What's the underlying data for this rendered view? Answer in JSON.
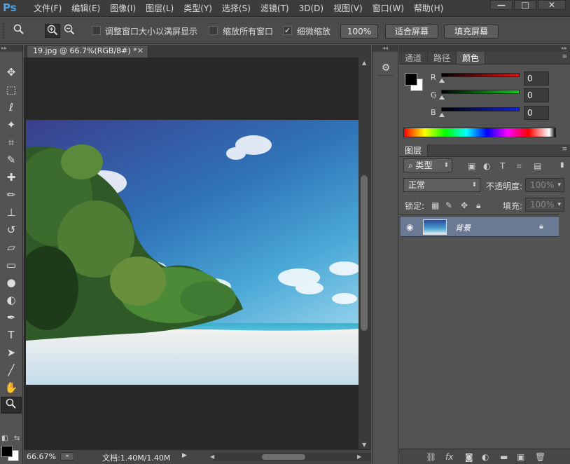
{
  "app": {
    "logo": "Ps"
  },
  "menu": [
    "文件(F)",
    "编辑(E)",
    "图像(I)",
    "图层(L)",
    "类型(Y)",
    "选择(S)",
    "滤镜(T)",
    "3D(D)",
    "视图(V)",
    "窗口(W)",
    "帮助(H)"
  ],
  "window_controls": {
    "minimize": "—",
    "maximize": "□",
    "close": "✕"
  },
  "options": {
    "resize_windows_label": "调整窗口大小以满屏显示",
    "zoom_all_label": "缩放所有窗口",
    "scrubby_zoom_label": "细微缩放",
    "scrubby_zoom_checked": true,
    "btn_100": "100%",
    "btn_fit": "适合屏幕",
    "btn_fill": "填充屏幕"
  },
  "document": {
    "tab_title": "19.jpg @ 66.7%(RGB/8#) *",
    "zoom": "66.67%",
    "doc_info": "文档:1.40M/1.40M"
  },
  "color_panel": {
    "tabs": [
      "通道",
      "路径",
      "颜色"
    ],
    "active_tab": "颜色",
    "r_label": "R",
    "r_value": "0",
    "g_label": "G",
    "g_value": "0",
    "b_label": "B",
    "b_value": "0"
  },
  "layers_panel": {
    "tab": "图层",
    "filter_label": "类型",
    "blend_mode": "正常",
    "opacity_label": "不透明度:",
    "opacity_value": "100%",
    "lock_label": "锁定:",
    "fill_label": "填充:",
    "fill_value": "100%",
    "layers": [
      {
        "name": "背景",
        "locked": true,
        "visible": true
      }
    ]
  },
  "colors": {
    "foreground": "#000000",
    "background": "#ffffff",
    "selected_layer": "#6b7a94"
  }
}
